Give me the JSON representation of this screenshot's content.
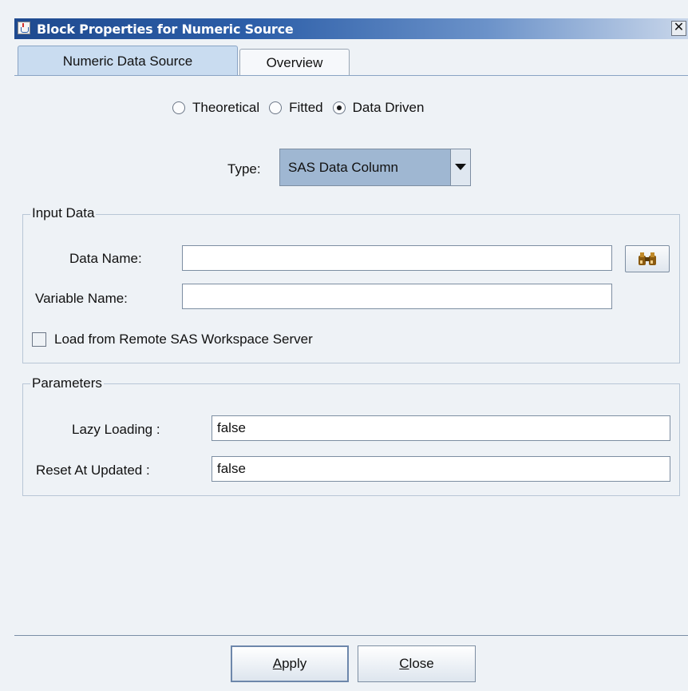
{
  "window": {
    "title": "Block Properties for Numeric Source",
    "close_glyph": "✕"
  },
  "tabs": [
    {
      "label": "Numeric Data Source",
      "active": true
    },
    {
      "label": "Overview",
      "active": false
    }
  ],
  "source_mode": {
    "options": [
      {
        "label": "Theoretical",
        "selected": false
      },
      {
        "label": "Fitted",
        "selected": false
      },
      {
        "label": "Data Driven",
        "selected": true
      }
    ]
  },
  "type": {
    "label": "Type:",
    "value": "SAS Data Column"
  },
  "input_data": {
    "title": "Input Data",
    "data_name_label": "Data Name:",
    "data_name_value": "",
    "browse_icon": "binoculars-icon",
    "variable_name_label": "Variable Name:",
    "variable_name_value": "",
    "remote_label": "Load from Remote SAS Workspace Server",
    "remote_checked": false
  },
  "parameters": {
    "title": "Parameters",
    "lazy_loading_label": "Lazy Loading :",
    "lazy_loading_value": "false",
    "reset_label": "Reset At Updated :",
    "reset_value": "false"
  },
  "buttons": {
    "apply_mnemonic": "A",
    "apply_rest": "pply",
    "close_mnemonic": "C",
    "close_rest": "lose"
  },
  "colors": {
    "titlebar_start": "#1f4a8f",
    "tab_active": "#c9dcf0",
    "combo_bg": "#9fb7d2"
  }
}
